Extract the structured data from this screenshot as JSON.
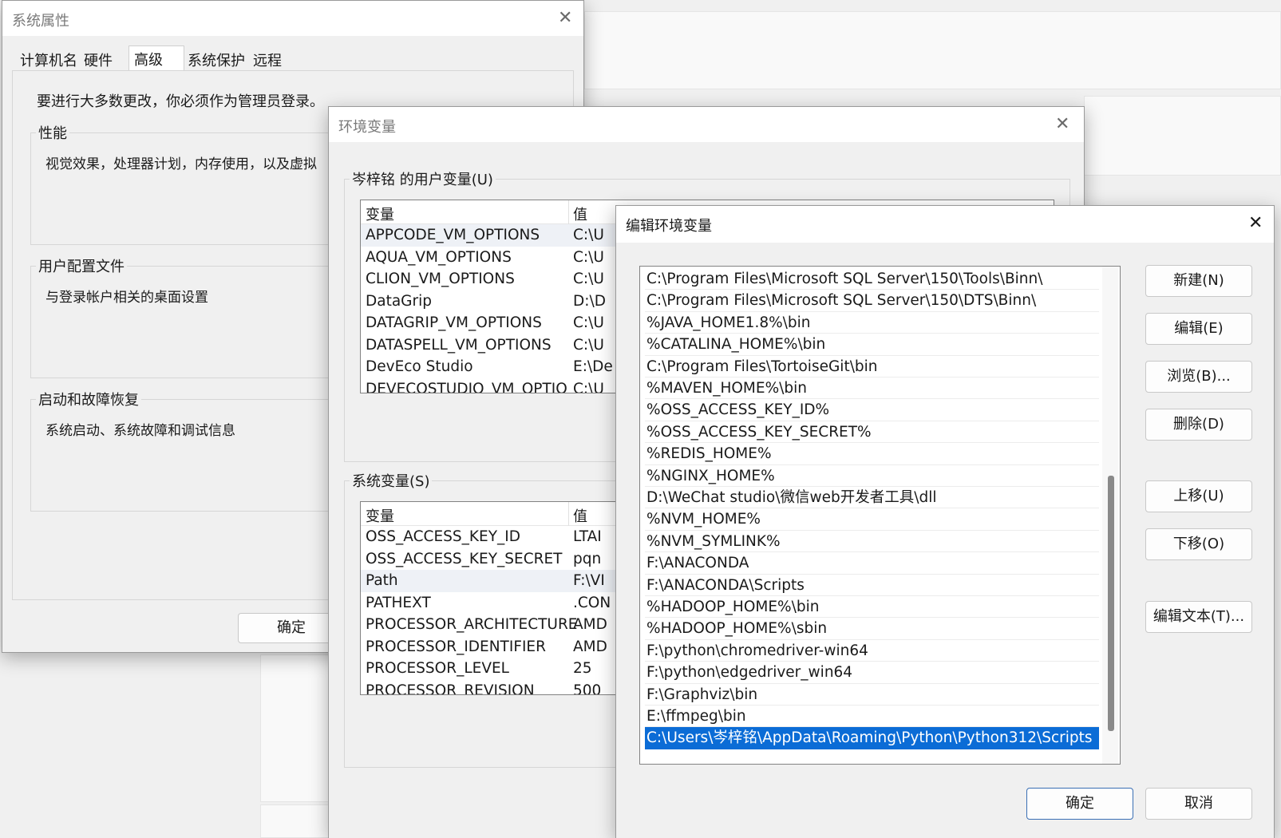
{
  "sysprops": {
    "title": "系统属性",
    "tabs": [
      "计算机名",
      "硬件",
      "高级",
      "系统保护",
      "远程"
    ],
    "notice": "要进行大多数更改，你必须作为管理员登录。",
    "performance": {
      "legend": "性能",
      "desc": "视觉效果，处理器计划，内存使用，以及虚拟"
    },
    "profile": {
      "legend": "用户配置文件",
      "desc": "与登录帐户相关的桌面设置"
    },
    "startup": {
      "legend": "启动和故障恢复",
      "desc": "系统启动、系统故障和调试信息"
    },
    "ok": "确定"
  },
  "envvars": {
    "title": "环境变量",
    "user_group": "岑梓铭 的用户变量(U)",
    "user_columns": [
      "变量",
      "值"
    ],
    "user_rows": [
      {
        "k": "APPCODE_VM_OPTIONS",
        "v": "C:\\U"
      },
      {
        "k": "AQUA_VM_OPTIONS",
        "v": "C:\\U"
      },
      {
        "k": "CLION_VM_OPTIONS",
        "v": "C:\\U"
      },
      {
        "k": "DataGrip",
        "v": "D:\\D"
      },
      {
        "k": "DATAGRIP_VM_OPTIONS",
        "v": "C:\\U"
      },
      {
        "k": "DATASPELL_VM_OPTIONS",
        "v": "C:\\U"
      },
      {
        "k": "DevEco Studio",
        "v": "E:\\De"
      },
      {
        "k": "DEVECOSTUDIO_VM_OPTIO",
        "v": "C:\\U"
      }
    ],
    "sys_group": "系统变量(S)",
    "sys_columns": [
      "变量",
      "值"
    ],
    "sys_rows": [
      {
        "k": "OSS_ACCESS_KEY_ID",
        "v": "LTAI"
      },
      {
        "k": "OSS_ACCESS_KEY_SECRET",
        "v": "pqn"
      },
      {
        "k": "Path",
        "v": "F:\\VI"
      },
      {
        "k": "PATHEXT",
        "v": ".CON"
      },
      {
        "k": "PROCESSOR_ARCHITECTURE",
        "v": "AMD"
      },
      {
        "k": "PROCESSOR_IDENTIFIER",
        "v": "AMD"
      },
      {
        "k": "PROCESSOR_LEVEL",
        "v": "25"
      },
      {
        "k": "PROCESSOR_REVISION",
        "v": "500"
      }
    ]
  },
  "editenv": {
    "title": "编辑环境变量",
    "paths": [
      "C:\\Program Files\\Microsoft SQL Server\\150\\Tools\\Binn\\",
      "C:\\Program Files\\Microsoft SQL Server\\150\\DTS\\Binn\\",
      "%JAVA_HOME1.8%\\bin",
      "%CATALINA_HOME%\\bin",
      "C:\\Program Files\\TortoiseGit\\bin",
      "%MAVEN_HOME%\\bin",
      "%OSS_ACCESS_KEY_ID%",
      "%OSS_ACCESS_KEY_SECRET%",
      "%REDIS_HOME%",
      "%NGINX_HOME%",
      "D:\\WeChat studio\\微信web开发者工具\\dll",
      "%NVM_HOME%",
      "%NVM_SYMLINK%",
      "F:\\ANACONDA",
      "F:\\ANACONDA\\Scripts",
      "%HADOOP_HOME%\\bin",
      "%HADOOP_HOME%\\sbin",
      "F:\\python\\chromedriver-win64",
      "F:\\python\\edgedriver_win64",
      "F:\\Graphviz\\bin",
      "E:\\ffmpeg\\bin",
      "C:\\Users\\岑梓铭\\AppData\\Roaming\\Python\\Python312\\Scripts"
    ],
    "buttons": {
      "new": "新建(N)",
      "edit": "编辑(E)",
      "browse": "浏览(B)...",
      "delete": "删除(D)",
      "up": "上移(U)",
      "down": "下移(O)",
      "edit_text": "编辑文本(T)...",
      "ok": "确定",
      "cancel": "取消"
    }
  },
  "icons": {
    "close": "close-icon"
  },
  "colors": {
    "selection": "#0b6cd6",
    "accent_border": "#3a6fb4"
  }
}
